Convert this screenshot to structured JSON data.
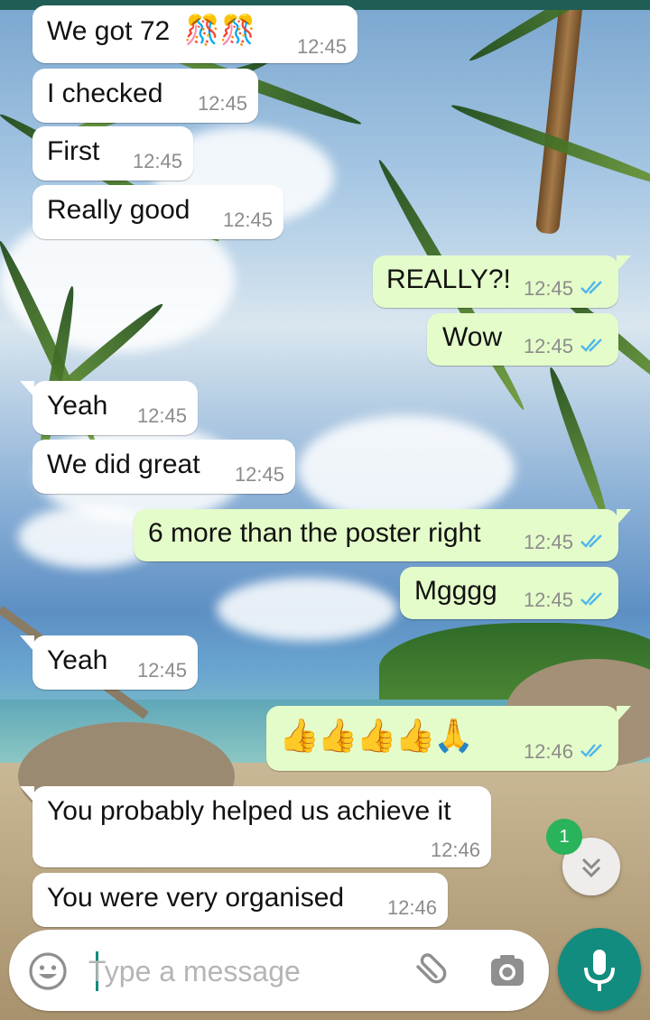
{
  "messages": [
    {
      "dir": "in",
      "text": "We got 72",
      "time": "12:45",
      "emoji": "🎊🎊"
    },
    {
      "dir": "in",
      "text": "I checked",
      "time": "12:45"
    },
    {
      "dir": "in",
      "text": "First",
      "time": "12:45"
    },
    {
      "dir": "in",
      "text": "Really good",
      "time": "12:45"
    },
    {
      "dir": "out",
      "text": "REALLY?!",
      "time": "12:45",
      "status": "read"
    },
    {
      "dir": "out",
      "text": "Wow",
      "time": "12:45",
      "status": "read"
    },
    {
      "dir": "in",
      "text": "Yeah",
      "time": "12:45"
    },
    {
      "dir": "in",
      "text": "We did great",
      "time": "12:45"
    },
    {
      "dir": "out",
      "text": "6 more than the poster right",
      "time": "12:45",
      "status": "read"
    },
    {
      "dir": "out",
      "text": "Mgggg",
      "time": "12:45",
      "status": "read"
    },
    {
      "dir": "in",
      "text": "Yeah",
      "time": "12:45"
    },
    {
      "dir": "out",
      "text": "👍👍👍👍🙏",
      "time": "12:46",
      "status": "read"
    },
    {
      "dir": "in",
      "text": "You probably helped us achieve it",
      "time": "12:46"
    },
    {
      "dir": "in",
      "text": "You were very organised",
      "time": "12:46"
    }
  ],
  "unread_count": "1",
  "input": {
    "placeholder": "Type a message",
    "value": ""
  },
  "icons": {
    "emoji": "emoji-icon",
    "attach": "paperclip-icon",
    "camera": "camera-icon",
    "mic": "microphone-icon",
    "scroll": "double-chevron-down-icon",
    "read": "double-check-icon"
  },
  "colors": {
    "incoming": "#ffffff",
    "outgoing": "#e4fcc9",
    "accent": "#128c7e",
    "read_tick": "#4fb6ec",
    "badge": "#29b35a",
    "timestamp": "#8c8c8c"
  }
}
